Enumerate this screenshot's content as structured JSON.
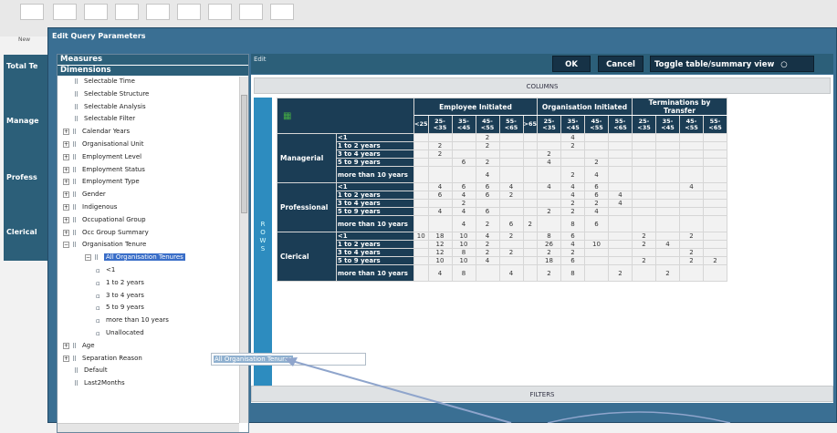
{
  "dialog": {
    "title": "Edit Query Parameters"
  },
  "background": {
    "new_label": "New",
    "left_labels": [
      "Total Te",
      "Manage",
      "Profess",
      "Clerical"
    ]
  },
  "left_pane": {
    "measures_header": "Measures",
    "dimensions_header": "Dimensions",
    "tree": [
      {
        "label": "Selectable Time"
      },
      {
        "label": "Selectable Structure"
      },
      {
        "label": "Selectable Analysis"
      },
      {
        "label": "Selectable Filter"
      },
      {
        "label": "Calendar Years"
      },
      {
        "label": "Organisational Unit"
      },
      {
        "label": "Employment Level"
      },
      {
        "label": "Employment Status"
      },
      {
        "label": "Employment Type"
      },
      {
        "label": "Gender"
      },
      {
        "label": "Indigenous"
      },
      {
        "label": "Occupational Group"
      },
      {
        "label": "Occ Group Summary"
      },
      {
        "label": "Organisation Tenure"
      },
      {
        "label": "All Organisation Tenures"
      },
      {
        "label": "<1"
      },
      {
        "label": "1 to 2 years"
      },
      {
        "label": "3 to 4 years"
      },
      {
        "label": "5 to 9 years"
      },
      {
        "label": "more than 10 years"
      },
      {
        "label": "Unallocated"
      },
      {
        "label": "Age"
      },
      {
        "label": "Separation Reason"
      },
      {
        "label": "Default"
      },
      {
        "label": "Last2Months"
      }
    ]
  },
  "toolbar": {
    "edit_label": "Edit",
    "ok": "OK",
    "cancel": "Cancel",
    "toggle": "Toggle table/summary view"
  },
  "columns_label": "COLUMNS",
  "rows_label": "ROWS",
  "filters_label": "FILTERS",
  "drag_ghost": "All Organisation Tenures",
  "pivot": {
    "groups": [
      "Employee Initiated",
      "Organisation Initiated",
      "Terminations by Transfer"
    ],
    "age_cols": [
      "<25",
      "25-<35",
      "35-<45",
      "45-<55",
      "55-<65",
      ">65",
      "25-<35",
      "35-<45",
      "45-<55",
      "55-<65",
      "25-<35",
      "35-<45",
      "45-<55",
      "55-<65"
    ],
    "categories": [
      {
        "name": "Managerial",
        "rows": [
          {
            "label": "<1",
            "cells": [
              "",
              "",
              "",
              "2",
              "",
              "",
              "",
              "4",
              "",
              "",
              "",
              "",
              "",
              ""
            ]
          },
          {
            "label": "1 to 2 years",
            "cells": [
              "",
              "2",
              "",
              "2",
              "",
              "",
              "",
              "2",
              "",
              "",
              "",
              "",
              "",
              ""
            ]
          },
          {
            "label": "3 to 4 years",
            "cells": [
              "",
              "2",
              "",
              "",
              "",
              "",
              "2",
              "",
              "",
              "",
              "",
              "",
              "",
              ""
            ]
          },
          {
            "label": "5 to 9 years",
            "cells": [
              "",
              "",
              "6",
              "2",
              "",
              "",
              "4",
              "",
              "2",
              "",
              "",
              "",
              "",
              ""
            ]
          },
          {
            "label": "more than 10 years",
            "cells": [
              "",
              "",
              "",
              "4",
              "",
              "",
              "",
              "2",
              "4",
              "",
              "",
              "",
              "",
              ""
            ]
          }
        ]
      },
      {
        "name": "Professional",
        "rows": [
          {
            "label": "<1",
            "cells": [
              "",
              "4",
              "6",
              "6",
              "4",
              "",
              "4",
              "4",
              "6",
              "",
              "",
              "",
              "4",
              ""
            ]
          },
          {
            "label": "1 to 2 years",
            "cells": [
              "",
              "6",
              "4",
              "6",
              "2",
              "",
              "",
              "4",
              "6",
              "4",
              "",
              "",
              "",
              ""
            ]
          },
          {
            "label": "3 to 4 years",
            "cells": [
              "",
              "",
              "2",
              "",
              "",
              "",
              "",
              "2",
              "2",
              "4",
              "",
              "",
              "",
              ""
            ]
          },
          {
            "label": "5 to 9 years",
            "cells": [
              "",
              "4",
              "4",
              "6",
              "",
              "",
              "2",
              "2",
              "4",
              "",
              "",
              "",
              "",
              ""
            ]
          },
          {
            "label": "more than 10 years",
            "cells": [
              "",
              "",
              "4",
              "2",
              "6",
              "2",
              "",
              "8",
              "6",
              "",
              "",
              "",
              "",
              ""
            ]
          }
        ]
      },
      {
        "name": "Clerical",
        "rows": [
          {
            "label": "<1",
            "cells": [
              "10",
              "18",
              "10",
              "4",
              "2",
              "",
              "8",
              "6",
              "",
              "",
              "2",
              "",
              "2",
              ""
            ]
          },
          {
            "label": "1 to 2 years",
            "cells": [
              "",
              "12",
              "10",
              "2",
              "",
              "",
              "26",
              "4",
              "10",
              "",
              "2",
              "4",
              "",
              ""
            ]
          },
          {
            "label": "3 to 4 years",
            "cells": [
              "",
              "12",
              "8",
              "2",
              "2",
              "",
              "2",
              "2",
              "",
              "",
              "",
              "",
              "2",
              ""
            ]
          },
          {
            "label": "5 to 9 years",
            "cells": [
              "",
              "10",
              "10",
              "4",
              "",
              "",
              "18",
              "6",
              "",
              "",
              "2",
              "",
              "2",
              "2"
            ]
          },
          {
            "label": "more than 10 years",
            "cells": [
              "",
              "4",
              "8",
              "",
              "4",
              "",
              "2",
              "8",
              "",
              "2",
              "",
              "2",
              "",
              ""
            ]
          }
        ]
      }
    ]
  }
}
